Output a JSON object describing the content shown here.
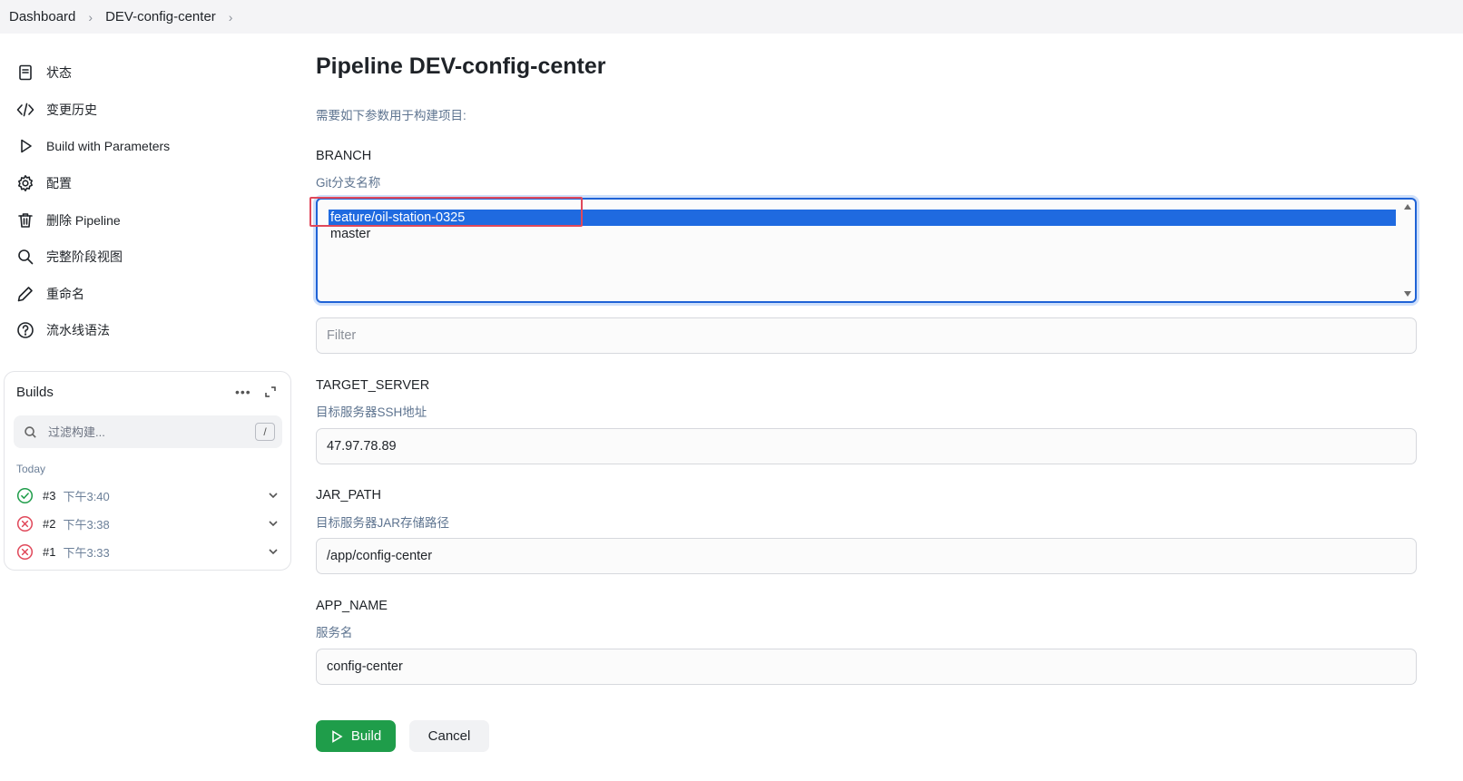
{
  "breadcrumb": {
    "items": [
      "Dashboard",
      "DEV-config-center"
    ]
  },
  "sidebar": {
    "items": [
      {
        "label": "状态",
        "icon": "document-icon"
      },
      {
        "label": "变更历史",
        "icon": "code-icon"
      },
      {
        "label": "Build with Parameters",
        "icon": "play-icon"
      },
      {
        "label": "配置",
        "icon": "gear-icon"
      },
      {
        "label": "删除 Pipeline",
        "icon": "trash-icon"
      },
      {
        "label": "完整阶段视图",
        "icon": "search-icon"
      },
      {
        "label": "重命名",
        "icon": "pencil-icon"
      },
      {
        "label": "流水线语法",
        "icon": "help-icon"
      }
    ]
  },
  "builds": {
    "title": "Builds",
    "more": "•••",
    "filter_placeholder": "过滤构建...",
    "shortcut": "/",
    "group": "Today",
    "items": [
      {
        "number": "#3",
        "time": "下午3:40",
        "status": "success"
      },
      {
        "number": "#2",
        "time": "下午3:38",
        "status": "failed"
      },
      {
        "number": "#1",
        "time": "下午3:33",
        "status": "failed"
      }
    ]
  },
  "main": {
    "title": "Pipeline DEV-config-center",
    "description": "需要如下参数用于构建项目:",
    "params": {
      "branch": {
        "name": "BRANCH",
        "description": "Git分支名称",
        "options": [
          "feature/oil-station-0325",
          "master"
        ],
        "selected": "feature/oil-station-0325",
        "filter_placeholder": "Filter"
      },
      "target_server": {
        "name": "TARGET_SERVER",
        "description": "目标服务器SSH地址",
        "value": "47.97.78.89"
      },
      "jar_path": {
        "name": "JAR_PATH",
        "description": "目标服务器JAR存储路径",
        "value": "/app/config-center"
      },
      "app_name": {
        "name": "APP_NAME",
        "description": "服务名",
        "value": "config-center"
      }
    },
    "build_label": "Build",
    "cancel_label": "Cancel"
  },
  "colors": {
    "accent": "#1f6ae0",
    "success": "#1f9d4a",
    "failure": "#e0485a",
    "highlight": "#e0485a"
  }
}
